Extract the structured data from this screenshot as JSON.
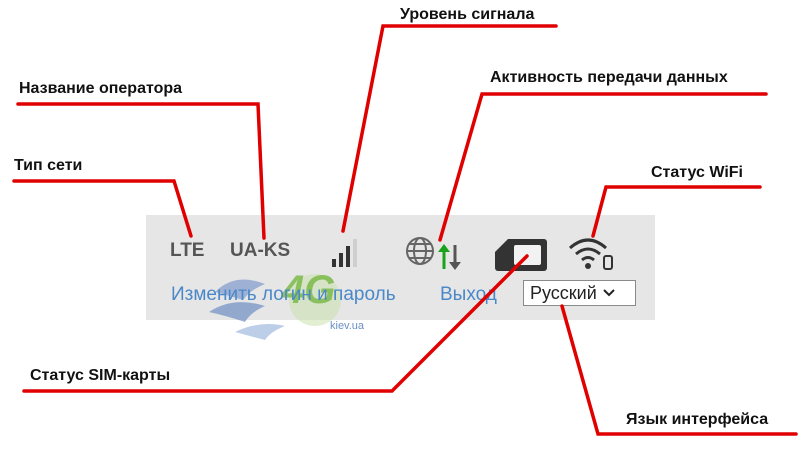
{
  "callouts": {
    "signal_level": "Уровень сигнала",
    "operator_name": "Название оператора",
    "data_activity": "Активность передачи данных",
    "network_type": "Тип сети",
    "wifi_status": "Статус WiFi",
    "sim_status": "Статус SIM-карты",
    "interface_language": "Язык интерфейса"
  },
  "status_bar": {
    "network_type": "LTE",
    "operator": "UA-KS",
    "change_credentials_link": "Изменить логин и пароль",
    "logout_link": "Выход",
    "language_selected": "Русский"
  },
  "icons": {
    "signal": "signal-bars-icon",
    "data_activity": "globe-updown-arrows-icon",
    "sim": "sim-card-icon",
    "wifi": "wifi-icon",
    "dropdown": "chevron-down-icon"
  },
  "watermark": {
    "logo_text": "4G",
    "site": "kiev.ua"
  },
  "colors": {
    "callout_line": "#e00000",
    "link": "#4a88c9",
    "panel_bg": "#e6e6e6",
    "upload_arrow": "#1aa31a"
  }
}
